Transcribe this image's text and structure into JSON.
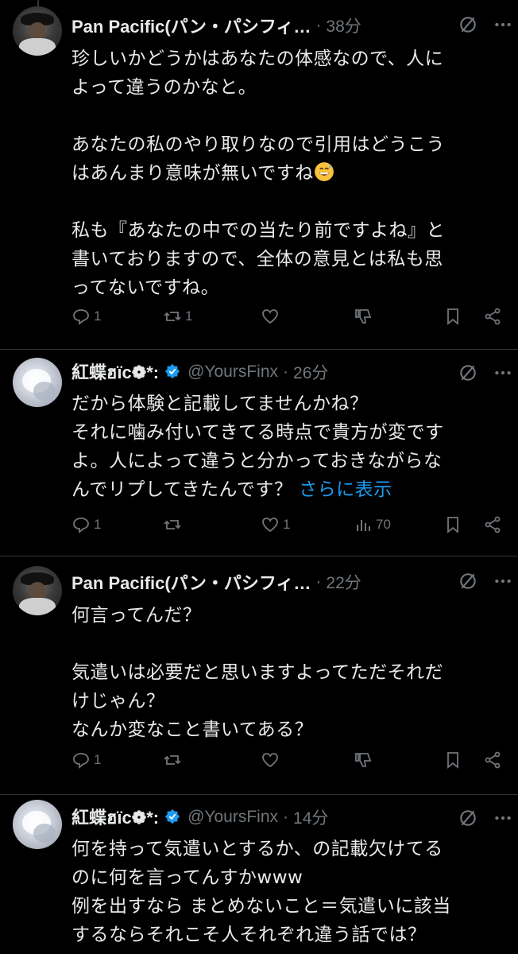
{
  "tweets": [
    {
      "author": "Pan Pacific(パン・パシフィ…",
      "handle": "",
      "time": "38分",
      "text": "珍しいかどうかはあなたの体感なので、人に\nよって違うのかなと。\n\nあなたの私のやり取りなので引用はどうこう\nはあんまり意味が無いですね",
      "text2": "\n\n私も『あなたの中での当たり前ですよね』と\n書いておりますので、全体の意見とは私も思\nってないですね。",
      "emoji": "sweat-smile-emoji",
      "replies": "1",
      "retweets": "1",
      "likes": "",
      "views": ""
    },
    {
      "author": "紅蝶ฮïc❁*:",
      "handle": "@YoursFinx",
      "time": "26分",
      "text": "だから体験と記載してませんかね？\nそれに噛み付いてきてる時点で貴方が変です\nよ。人によって違うと分かっておきながらな\nんでリプしてきたんです？ ",
      "show_more": "さらに表示",
      "replies": "1",
      "retweets": "",
      "likes": "1",
      "views": "70"
    },
    {
      "author": "Pan Pacific(パン・パシフィ…",
      "handle": "",
      "time": "22分",
      "text": "何言ってんだ？\n\n気遣いは必要だと思いますよってただそれだ\nけじゃん？\nなんか変なこと書いてある？",
      "replies": "1",
      "retweets": "",
      "likes": "",
      "views": ""
    },
    {
      "author": "紅蝶ฮïc❁*:",
      "handle": "@YoursFinx",
      "time": "14分",
      "text": "何を持って気遣いとするか、の記載欠けてる\nのに何を言ってんすかwww\n例を出すなら まとめないこと＝気遣いに該当\nするならそれこそ人それぞれ違う話では？"
    }
  ],
  "separator": "·",
  "colors": {
    "background": "#000000",
    "text": "#e7e9ea",
    "muted": "#71767b",
    "link": "#1d9bf0",
    "verified": "#1d9bf0"
  }
}
